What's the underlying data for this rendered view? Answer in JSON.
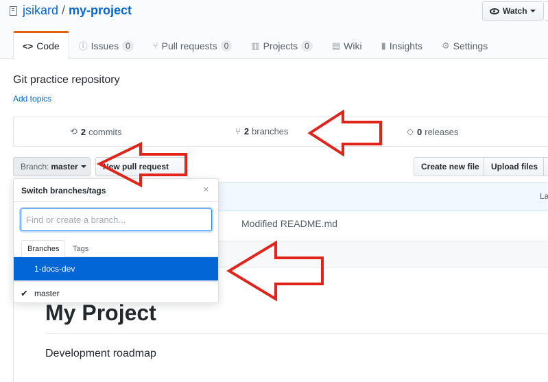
{
  "header": {
    "owner": "jsikard",
    "separator": "/",
    "repo": "my-project",
    "watch_label": "Watch"
  },
  "tabs": [
    {
      "label": "Code",
      "icon": "<>",
      "active": true
    },
    {
      "label": "Issues",
      "icon": "ⓘ",
      "count": "0"
    },
    {
      "label": "Pull requests",
      "icon": "⑂",
      "count": "0"
    },
    {
      "label": "Projects",
      "icon": "▥",
      "count": "0"
    },
    {
      "label": "Wiki",
      "icon": "▤"
    },
    {
      "label": "Insights",
      "icon": "▮"
    },
    {
      "label": "Settings",
      "icon": "⚙"
    }
  ],
  "repo_info": {
    "description": "Git practice repository",
    "add_topics": "Add topics"
  },
  "summary": {
    "commits_count": "2",
    "commits_label": "commits",
    "branches_count": "2",
    "branches_label": "branches",
    "releases_count": "0",
    "releases_label": "releases"
  },
  "toolbar": {
    "branch_prefix": "Branch:",
    "branch_value": "master",
    "new_pr": "New pull request",
    "create_file": "Create new file",
    "upload_files": "Upload files"
  },
  "commit_bar": {
    "latest": "Lat"
  },
  "file_row": {
    "message": "Modified README.md"
  },
  "readme": {
    "heading": "My Project",
    "paragraph": "Development roadmap"
  },
  "dropdown": {
    "title": "Switch branches/tags",
    "close": "×",
    "filter_placeholder": "Find or create a branch...",
    "tab_branches": "Branches",
    "tab_tags": "Tags",
    "branches": [
      {
        "name": "1-docs-dev",
        "highlighted": true,
        "checked": false
      },
      {
        "name": "master",
        "highlighted": false,
        "checked": true
      }
    ]
  },
  "annotation_color": "#e2231a"
}
